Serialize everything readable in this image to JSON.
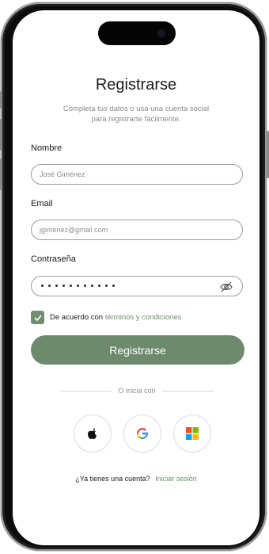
{
  "title": "Registrarse",
  "subtitle_line1": "Completa tus datos o usa una cuenta social",
  "subtitle_line2": "para registrarte fácilmente.",
  "fields": {
    "name": {
      "label": "Nombre",
      "value": "José Giménez"
    },
    "email": {
      "label": "Email",
      "value": "jgimenez@gmail.com"
    },
    "password": {
      "label": "Contraseña",
      "dots": 11
    }
  },
  "terms": {
    "prefix": "De acuerdo con",
    "link": "términos y condiciones",
    "checked": true
  },
  "primary_button": "Registrarse",
  "divider_text": "O inicia con",
  "social": [
    "apple-icon",
    "google-icon",
    "microsoft-icon"
  ],
  "footer": {
    "text": "¿Ya tienes una cuenta?",
    "link": "Iniciar sesión"
  },
  "colors": {
    "accent": "#6D8A6D",
    "link": "#6F8F70",
    "text": "#1B1B1B",
    "muted": "#8A8A8A"
  }
}
